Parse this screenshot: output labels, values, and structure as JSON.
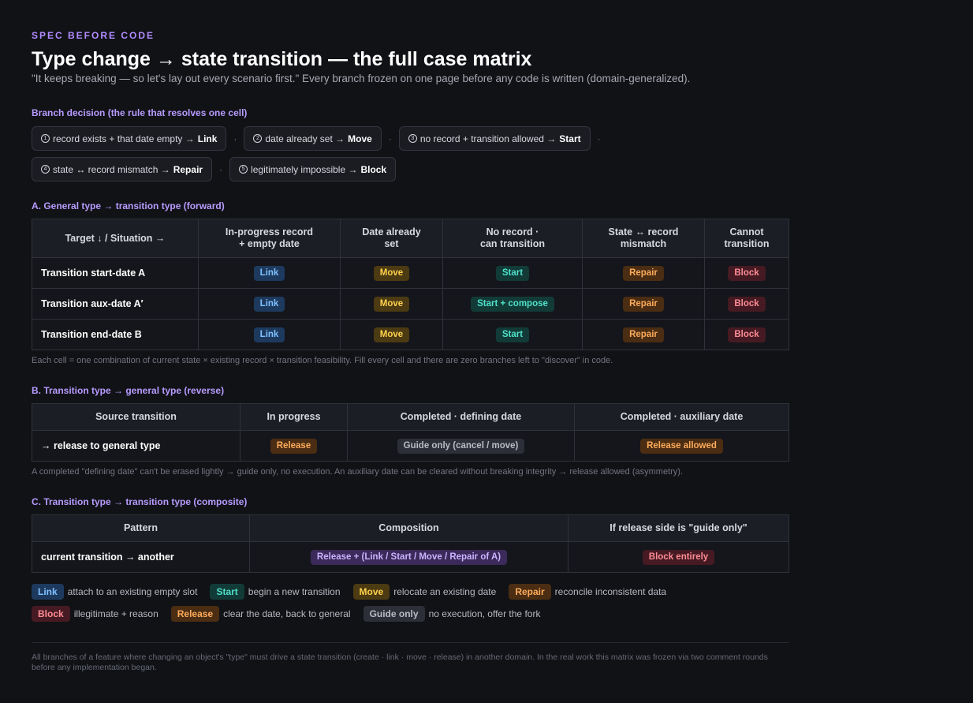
{
  "header": {
    "eyebrow": "SPEC BEFORE CODE",
    "title": "Type change → state transition — the full case matrix",
    "subtitle": "\"It keeps breaking — so let's lay out every scenario first.\" Every branch frozen on one page before any code is written (domain-generalized)."
  },
  "branch": {
    "title": "Branch decision (the rule that resolves one cell)",
    "rules": [
      {
        "num": "1",
        "text": "record exists + that date empty →",
        "result": "Link"
      },
      {
        "num": "2",
        "text": "date already set →",
        "result": "Move"
      },
      {
        "num": "3",
        "text": "no record + transition allowed →",
        "result": "Start"
      },
      {
        "num": "4",
        "text": "state ↔ record mismatch →",
        "result": "Repair"
      },
      {
        "num": "5",
        "text": "legitimately impossible →",
        "result": "Block"
      }
    ],
    "separator": "·"
  },
  "sectionA": {
    "title": "A. General type → transition type (forward)",
    "headers": [
      "Target ↓ / Situation →",
      "In-progress record\n+ empty date",
      "Date already\nset",
      "No record ·\ncan transition",
      "State ↔ record\nmismatch",
      "Cannot\ntransition"
    ],
    "rows": [
      {
        "label": "Transition start-date A",
        "cells": [
          "Link",
          "Move",
          "Start",
          "Repair",
          "Block"
        ]
      },
      {
        "label": "Transition aux-date A′",
        "cells": [
          "Link",
          "Move",
          "Start + compose",
          "Repair",
          "Block"
        ]
      },
      {
        "label": "Transition end-date B",
        "cells": [
          "Link",
          "Move",
          "Start",
          "Repair",
          "Block"
        ]
      }
    ],
    "note": "Each cell = one combination of current state × existing record × transition feasibility. Fill every cell and there are zero branches left to \"discover\" in code."
  },
  "sectionB": {
    "title": "B. Transition type → general type (reverse)",
    "headers": [
      "Source transition",
      "In progress",
      "Completed · defining date",
      "Completed · auxiliary date"
    ],
    "row": {
      "label": "→ release to general type",
      "cells": [
        "Release",
        "Guide only (cancel / move)",
        "Release allowed"
      ]
    },
    "note": "A completed \"defining date\" can't be erased lightly → guide only, no execution. An auxiliary date can be cleared without breaking integrity → release allowed (asymmetry)."
  },
  "sectionC": {
    "title": "C. Transition type → transition type (composite)",
    "headers": [
      "Pattern",
      "Composition",
      "If release side is \"guide only\""
    ],
    "row": {
      "label": "current transition → another",
      "cells": [
        "Release + (Link / Start / Move / Repair of A)",
        "Block entirely"
      ]
    }
  },
  "legend": {
    "row1": [
      {
        "tag": "Link",
        "desc": "attach to an existing empty slot"
      },
      {
        "tag": "Start",
        "desc": "begin a new transition"
      },
      {
        "tag": "Move",
        "desc": "relocate an existing date"
      },
      {
        "tag": "Repair",
        "desc": "reconcile inconsistent data"
      }
    ],
    "row2": [
      {
        "tag": "Block",
        "desc": "illegitimate + reason"
      },
      {
        "tag": "Release",
        "desc": "clear the date, back to general"
      },
      {
        "tag": "Guide only",
        "desc": "no execution, offer the fork"
      }
    ]
  },
  "footer": "All branches of a feature where changing an object's \"type\" must drive a state transition (create · link · move · release) in another domain. In the real work this matrix was frozen via two comment rounds before any implementation began.",
  "colors": {
    "accent": "#b18cff",
    "link": "#7fc1ff",
    "move": "#ffd24d",
    "start": "#4fe0c8",
    "repair": "#ffac5c",
    "block": "#ff8c96"
  }
}
